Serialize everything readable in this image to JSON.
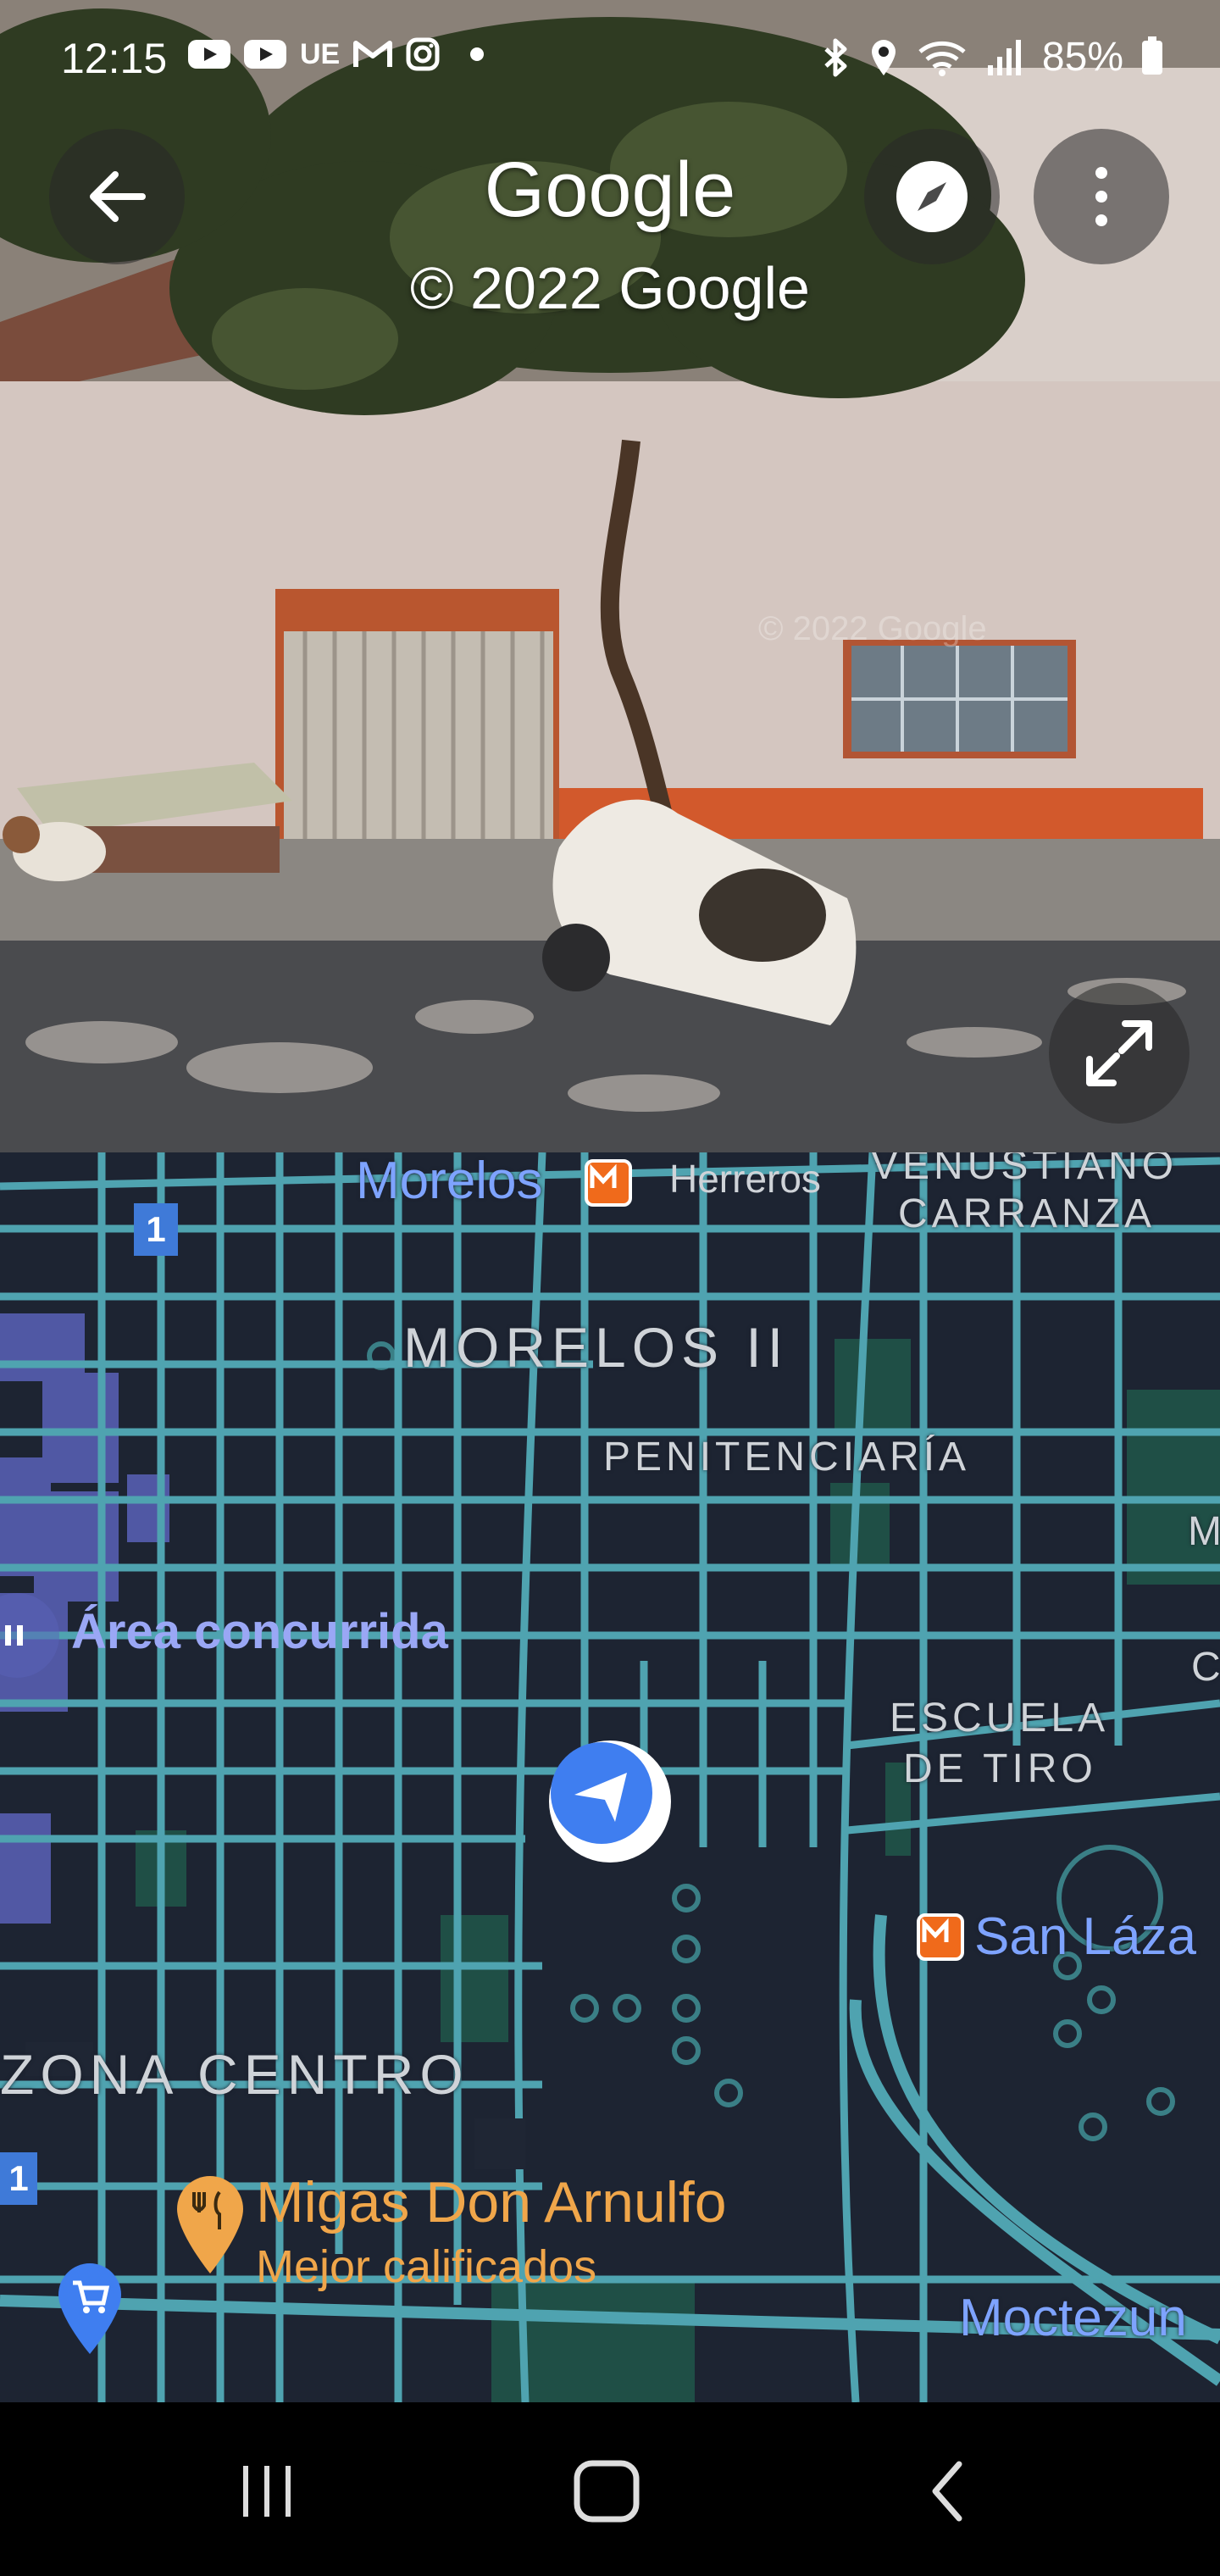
{
  "status_bar": {
    "time": "12:15",
    "left_icons": [
      "youtube-icon",
      "youtube-icon",
      "ue-icon",
      "gmail-icon",
      "instagram-icon",
      "dot-icon"
    ],
    "ue_label": "UE",
    "right_icons": [
      "bluetooth-icon",
      "location-icon",
      "wifi-icon",
      "signal-icon",
      "battery-icon"
    ],
    "battery": "85%"
  },
  "street_view": {
    "title": "Google",
    "copyright": "© 2022 Google",
    "watermark": "© 2022 Google",
    "back_icon": "arrow-left-icon",
    "compass_icon": "compass-icon",
    "menu_icon": "more-vertical-icon",
    "expand_icon": "expand-icon"
  },
  "map": {
    "labels": {
      "morelos_station": "Morelos",
      "herreros": "Herreros",
      "venustiano": "VENUSTIANO",
      "carranza": "CARRANZA",
      "morelos_ii": "MORELOS II",
      "penitenciaria": "PENITENCIARÍA",
      "busy_area": "Área concurrida",
      "escuela": "ESCUELA",
      "de_tiro": "DE TIRO",
      "san_lazaro": "San Láza",
      "zona_centro": "ZONA CENTRO",
      "poi_name": "Migas Don Arnulfo",
      "poi_sub": "Mejor calificados",
      "moctezuma": "Moctezun",
      "edge_m": "M",
      "edge_c": "C"
    },
    "shields": [
      "1",
      "1"
    ],
    "colors": {
      "background": "#1d2432",
      "street": "#4fa3b0",
      "block": "#262d3d",
      "park": "#1f4f46",
      "metro": "#f06a1b",
      "busy": "#5a62b8",
      "location": "#3f7ef0"
    }
  },
  "nav_bar": {
    "icons": [
      "recent-apps-icon",
      "home-icon",
      "back-icon"
    ]
  }
}
